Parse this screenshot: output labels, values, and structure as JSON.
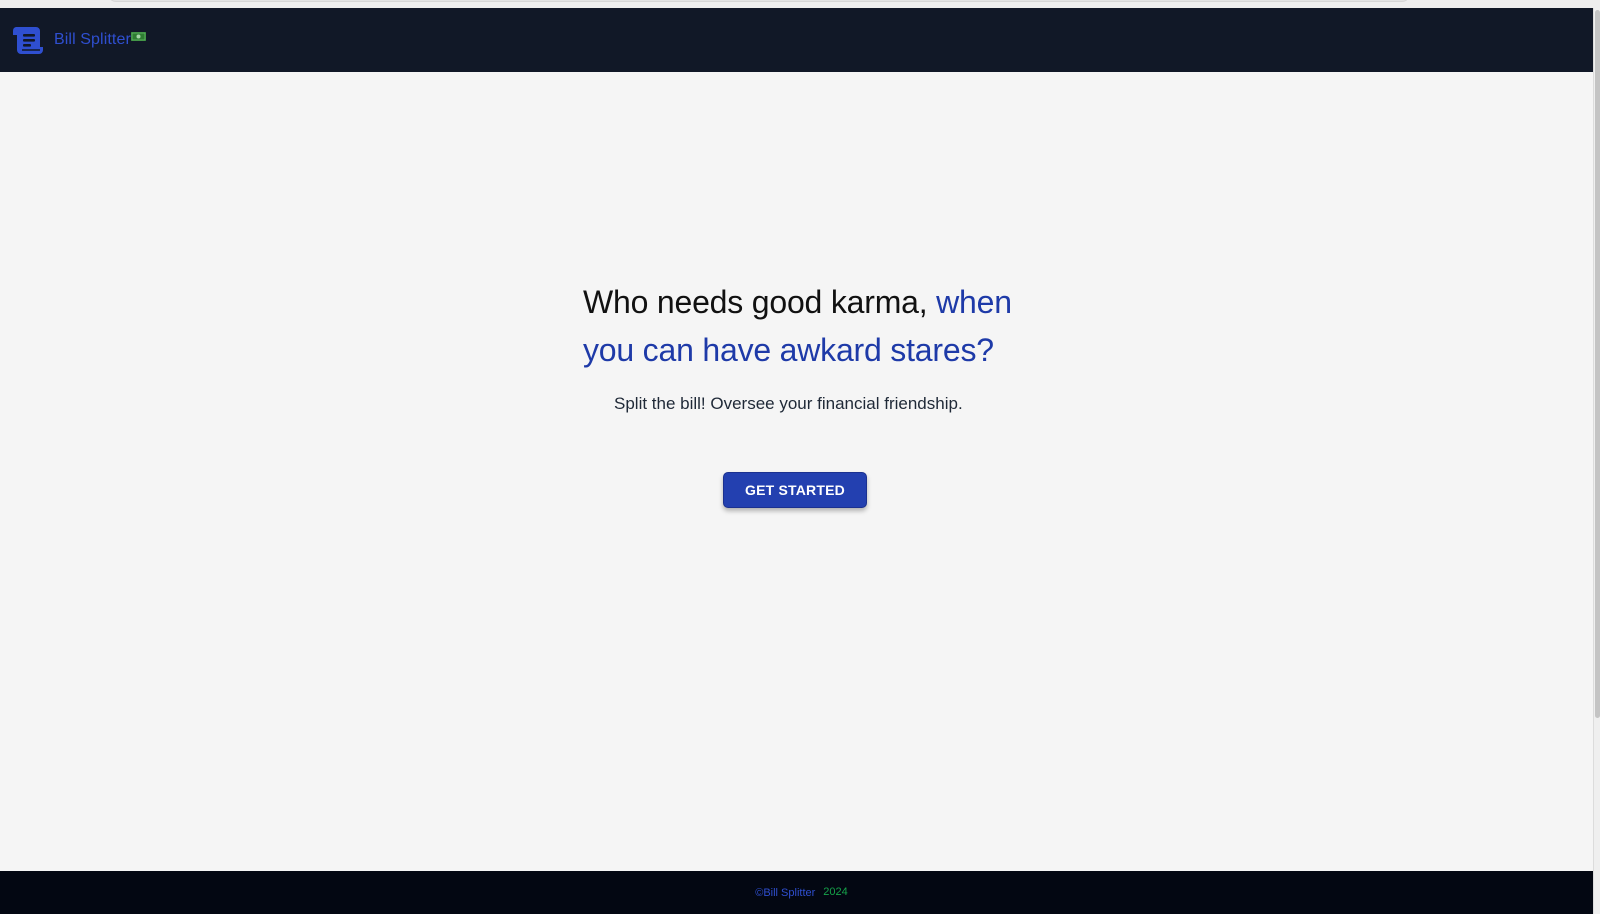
{
  "nav": {
    "brand_name": "Bill Splitter",
    "brand_icon": "scroll-icon",
    "money_icon": "dollar-bill-icon"
  },
  "hero": {
    "headline_part1": "Who needs good karma, ",
    "headline_part2": "when you can have awkard stares?",
    "subtitle": "Split the bill! Oversee your financial friendship.",
    "cta_label": "GET STARTED"
  },
  "footer": {
    "copyright": "©Bill Splitter",
    "year": "2024"
  },
  "colors": {
    "nav_bg": "#111827",
    "brand": "#2f4fd0",
    "accent_text": "#1e3aa8",
    "button_bg": "#2340b0",
    "footer_bg": "#030712",
    "year_green": "#16a34a",
    "page_bg": "#f5f5f5"
  }
}
